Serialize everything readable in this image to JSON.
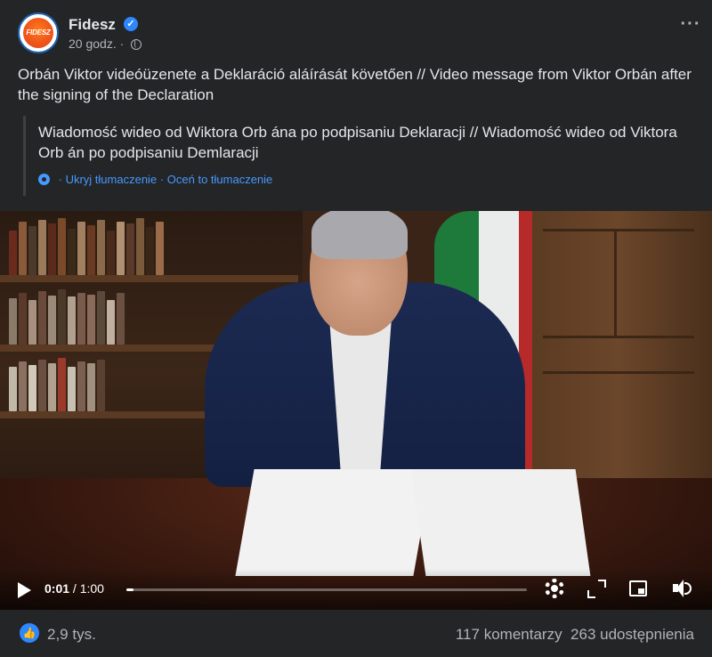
{
  "header": {
    "page_name": "Fidesz",
    "avatar_text": "FIDESZ",
    "time": "20 godz.",
    "separator": "·"
  },
  "post": {
    "text": "Orbán Viktor videóüzenete a Deklaráció aláírását követően // Video message from Viktor Orbán after the signing of the Declaration"
  },
  "translation": {
    "text": "Wiadomość wideo od Wiktora Orb ána po podpisaniu Deklaracji // Wiadomość wideo od Viktora Orb án po podpisaniu Demlaracji",
    "separator": "·",
    "hide_label": "Ukryj tłumaczenie",
    "rate_label": "Oceń to tłumaczenie"
  },
  "video": {
    "current_time": "0:01",
    "duration": " / 1:00",
    "progress_fraction": 0.017
  },
  "footer": {
    "likes": "2,9 tys.",
    "comments": "117 komentarzy",
    "shares": "263 udostępnienia"
  },
  "colors": {
    "background": "#242526",
    "accent": "#2d88ff",
    "link": "#4599ff",
    "secondary_text": "#b0b3b8"
  }
}
